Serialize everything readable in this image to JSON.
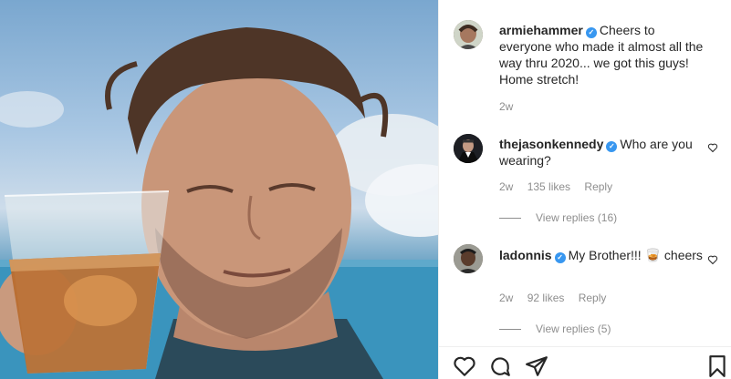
{
  "post": {
    "author": "armiehammer",
    "caption": "Cheers to everyone who made it almost all the way thru 2020... we got this guys! Home stretch!",
    "time": "2w"
  },
  "comments": [
    {
      "username": "thejasonkennedy",
      "text": "Who are you wearing?",
      "time": "2w",
      "likes": "135 likes",
      "reply_label": "Reply",
      "view_replies": "View replies (16)"
    },
    {
      "username": "ladonnis",
      "text": "My Brother!!! 🥃 cheers",
      "time": "2w",
      "likes": "92 likes",
      "reply_label": "Reply",
      "view_replies": "View replies (5)"
    }
  ],
  "icons": {
    "verified": "verified-badge-icon",
    "heart": "heart-icon",
    "comment": "comment-icon",
    "share": "share-icon",
    "save": "bookmark-icon"
  },
  "colors": {
    "accent": "#3897f0",
    "muted": "#8e8e8e",
    "text": "#262626"
  }
}
